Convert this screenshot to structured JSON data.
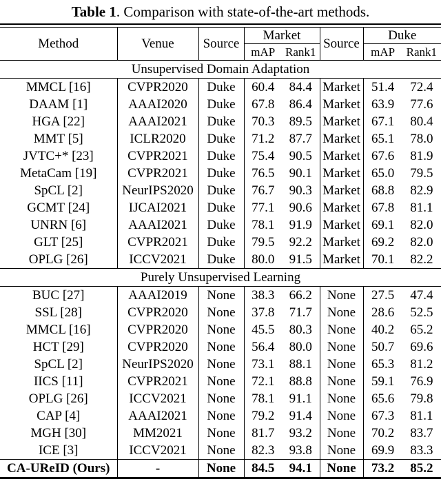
{
  "caption": {
    "label": "Table 1",
    "text": ". Comparison with state-of-the-art methods."
  },
  "header": {
    "method": "Method",
    "venue": "Venue",
    "source1": "Source",
    "market": "Market",
    "source2": "Source",
    "duke": "Duke",
    "map1": "mAP",
    "rank1_1": "Rank1",
    "map2": "mAP",
    "rank1_2": "Rank1"
  },
  "sections": [
    {
      "title": "Unsupervised Domain Adaptation",
      "rows": [
        {
          "method": "MMCL [16]",
          "venue": "CVPR2020",
          "source1": "Duke",
          "map1": "60.4",
          "rank1_1": "84.4",
          "source2": "Market",
          "map2": "51.4",
          "rank1_2": "72.4"
        },
        {
          "method": "DAAM [1]",
          "venue": "AAAI2020",
          "source1": "Duke",
          "map1": "67.8",
          "rank1_1": "86.4",
          "source2": "Market",
          "map2": "63.9",
          "rank1_2": "77.6"
        },
        {
          "method": "HGA [22]",
          "venue": "AAAI2021",
          "source1": "Duke",
          "map1": "70.3",
          "rank1_1": "89.5",
          "source2": "Market",
          "map2": "67.1",
          "rank1_2": "80.4"
        },
        {
          "method": "MMT [5]",
          "venue": "ICLR2020",
          "source1": "Duke",
          "map1": "71.2",
          "rank1_1": "87.7",
          "source2": "Market",
          "map2": "65.1",
          "rank1_2": "78.0"
        },
        {
          "method": "JVTC+* [23]",
          "venue": "CVPR2021",
          "source1": "Duke",
          "map1": "75.4",
          "rank1_1": "90.5",
          "source2": "Market",
          "map2": "67.6",
          "rank1_2": "81.9"
        },
        {
          "method": "MetaCam [19]",
          "venue": "CVPR2021",
          "source1": "Duke",
          "map1": "76.5",
          "rank1_1": "90.1",
          "source2": "Market",
          "map2": "65.0",
          "rank1_2": "79.5"
        },
        {
          "method": "SpCL [2]",
          "venue": "NeurIPS2020",
          "source1": "Duke",
          "map1": "76.7",
          "rank1_1": "90.3",
          "source2": "Market",
          "map2": "68.8",
          "rank1_2": "82.9"
        },
        {
          "method": "GCMT [24]",
          "venue": "IJCAI2021",
          "source1": "Duke",
          "map1": "77.1",
          "rank1_1": "90.6",
          "source2": "Market",
          "map2": "67.8",
          "rank1_2": "81.1"
        },
        {
          "method": "UNRN [6]",
          "venue": "AAAI2021",
          "source1": "Duke",
          "map1": "78.1",
          "rank1_1": "91.9",
          "source2": "Market",
          "map2": "69.1",
          "rank1_2": "82.0"
        },
        {
          "method": "GLT [25]",
          "venue": "CVPR2021",
          "source1": "Duke",
          "map1": "79.5",
          "rank1_1": "92.2",
          "source2": "Market",
          "map2": "69.2",
          "rank1_2": "82.0"
        },
        {
          "method": "OPLG [26]",
          "venue": "ICCV2021",
          "source1": "Duke",
          "map1": "80.0",
          "rank1_1": "91.5",
          "source2": "Market",
          "map2": "70.1",
          "rank1_2": "82.2"
        }
      ]
    },
    {
      "title": "Purely Unsupervised Learning",
      "rows": [
        {
          "method": "BUC [27]",
          "venue": "AAAI2019",
          "source1": "None",
          "map1": "38.3",
          "rank1_1": "66.2",
          "source2": "None",
          "map2": "27.5",
          "rank1_2": "47.4"
        },
        {
          "method": "SSL [28]",
          "venue": "CVPR2020",
          "source1": "None",
          "map1": "37.8",
          "rank1_1": "71.7",
          "source2": "None",
          "map2": "28.6",
          "rank1_2": "52.5"
        },
        {
          "method": "MMCL [16]",
          "venue": "CVPR2020",
          "source1": "None",
          "map1": "45.5",
          "rank1_1": "80.3",
          "source2": "None",
          "map2": "40.2",
          "rank1_2": "65.2"
        },
        {
          "method": "HCT [29]",
          "venue": "CVPR2020",
          "source1": "None",
          "map1": "56.4",
          "rank1_1": "80.0",
          "source2": "None",
          "map2": "50.7",
          "rank1_2": "69.6"
        },
        {
          "method": "SpCL [2]",
          "venue": "NeurIPS2020",
          "source1": "None",
          "map1": "73.1",
          "rank1_1": "88.1",
          "source2": "None",
          "map2": "65.3",
          "rank1_2": "81.2"
        },
        {
          "method": "IICS [11]",
          "venue": "CVPR2021",
          "source1": "None",
          "map1": "72.1",
          "rank1_1": "88.8",
          "source2": "None",
          "map2": "59.1",
          "rank1_2": "76.9"
        },
        {
          "method": "OPLG [26]",
          "venue": "ICCV2021",
          "source1": "None",
          "map1": "78.1",
          "rank1_1": "91.1",
          "source2": "None",
          "map2": "65.6",
          "rank1_2": "79.8"
        },
        {
          "method": "CAP [4]",
          "venue": "AAAI2021",
          "source1": "None",
          "map1": "79.2",
          "rank1_1": "91.4",
          "source2": "None",
          "map2": "67.3",
          "rank1_2": "81.1"
        },
        {
          "method": "MGH [30]",
          "venue": "MM2021",
          "source1": "None",
          "map1": "81.7",
          "rank1_1": "93.2",
          "source2": "None",
          "map2": "70.2",
          "rank1_2": "83.7"
        },
        {
          "method": "ICE [3]",
          "venue": "ICCV2021",
          "source1": "None",
          "map1": "82.3",
          "rank1_1": "93.8",
          "source2": "None",
          "map2": "69.9",
          "rank1_2": "83.3"
        }
      ]
    }
  ],
  "ours": {
    "method": "CA-UReID (Ours)",
    "venue": "-",
    "source1": "None",
    "map1": "84.5",
    "rank1_1": "94.1",
    "source2": "None",
    "map2": "73.2",
    "rank1_2": "85.2"
  }
}
